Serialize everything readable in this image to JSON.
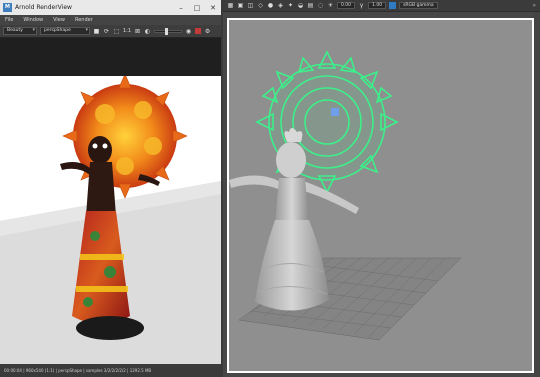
{
  "render_view": {
    "title": "Arnold RenderView",
    "menu": [
      "File",
      "Window",
      "View",
      "Render"
    ],
    "toolbar": {
      "aov_select": "Beauty",
      "camera_select": "perspShape",
      "ratio_label": "1:1"
    },
    "status": "00:00:04 | 960x540 (1:1) | perspShape | samples 3/2/2/2/2/2 | 1292.5 MB"
  },
  "viewport": {
    "toolbar": {
      "exposure_value": "0.00",
      "gamma_value": "1.00",
      "color_space": "sRGB gamma"
    }
  }
}
